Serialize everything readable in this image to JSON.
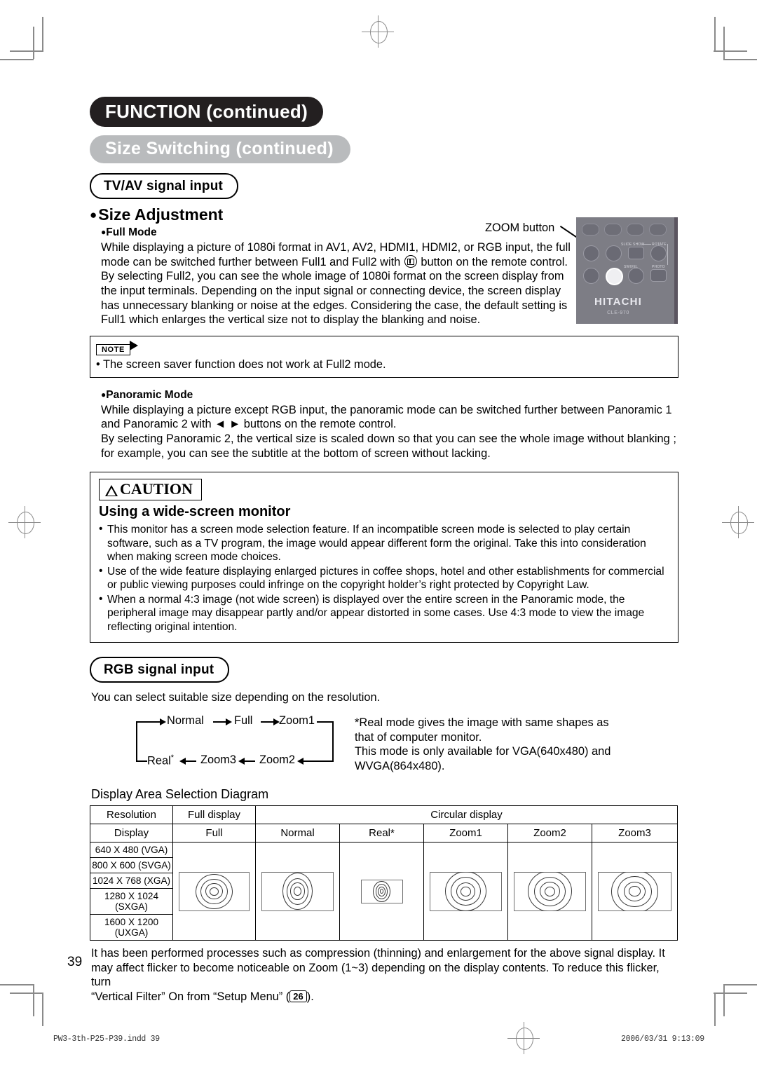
{
  "header": {
    "section_title": "FUNCTION (continued)",
    "subsection_title": "Size Switching (continued)",
    "signal_pill": "TV/AV signal input"
  },
  "size_adjustment": {
    "heading": "Size Adjustment",
    "full_mode": {
      "heading": "Full Mode",
      "lines": [
        "While displaying a picture of 1080i format in AV1, AV2, HDMI1, HDMI2, or RGB input, the full",
        "mode can be switched further between Full1 and Full2 with ",
        " button on the remote control.",
        "By selecting Full2, you can see the whole image of 1080i format on the screen display from",
        "the input terminals.  Depending on the input signal or connecting device, the screen display",
        "has unnecessary blanking or noise at the edges.  Considering the case, the default setting is",
        "Full1 which enlarges the vertical size not to display the blanking and noise."
      ]
    },
    "note": {
      "label": "NOTE",
      "text": "• The screen saver function does not work at Full2 mode."
    },
    "panoramic_mode": {
      "heading": "Panoramic Mode",
      "lines": [
        "While displaying a picture except RGB input, the panoramic mode can be switched further between Panoramic 1",
        "and Panoramic 2 with ◄ ► buttons on the remote control.",
        "By selecting Panoramic 2, the vertical size is scaled down so that you can see the whole image without blanking ;",
        "for example, you can see the subtitle at the bottom of screen without lacking."
      ]
    }
  },
  "remote": {
    "callout": "ZOOM button",
    "brand": "HITACHI",
    "model": "CLE-970",
    "labels": {
      "slide_show": "SLIDE SHOW",
      "rotate": "ROTATE",
      "swivel": "SWIVEL",
      "photo": "PHOTO"
    }
  },
  "caution": {
    "title": "CAUTION",
    "subtitle": "Using a wide-screen monitor",
    "bullets": [
      "This monitor has a screen mode selection feature. If an incompatible screen mode is selected to play certain software, such as a TV program, the image would appear different form the original. Take this into consideration when making screen mode choices.",
      "Use of the wide feature displaying enlarged pictures in coffee shops, hotel and other establishments for commercial or public viewing purposes could infringe on the copyright holder’s right protected by Copyright Law.",
      "When a normal 4:3 image (not wide screen) is displayed over the entire screen in the Panoramic mode, the peripheral image may disappear partly and/or appear distorted in some cases. Use 4:3 mode to view the image reflecting original intention."
    ]
  },
  "rgb": {
    "pill": "RGB signal input",
    "intro": "You can select suitable size depending on the resolution.",
    "flow_top": [
      "Normal",
      "Full",
      "Zoom1"
    ],
    "flow_bottom": [
      "Real",
      "Zoom3",
      "Zoom2"
    ],
    "flow_real_star": "*",
    "note_lines": [
      "*Real mode gives the image with same shapes as",
      " that of computer monitor.",
      "This mode is only available for VGA(640x480) and",
      "WVGA(864x480)."
    ]
  },
  "table": {
    "title": "Display Area Selection Diagram",
    "header_row1": [
      "Resolution",
      "Full display",
      "Circular display"
    ],
    "header_row2": [
      "Display",
      "Full",
      "Normal",
      "Real*",
      "Zoom1",
      "Zoom2",
      "Zoom3"
    ],
    "resolutions": [
      "640 X 480 (VGA)",
      "800 X 600 (SVGA)",
      "1024 X 768 (XGA)",
      "1280 X 1024 (SXGA)",
      "1600 X 1200 (UXGA)"
    ]
  },
  "footer_body": {
    "lines": [
      "It has been performed processes such as compression (thinning) and enlargement for the above signal display. It",
      "may affect flicker to become noticeable on Zoom (1~3) depending on the display contents. To reduce this flicker, turn",
      "“Vertical Filter” On from “Setup Menu” (",
      ")."
    ],
    "page_ref": "26",
    "page_number": "39"
  },
  "print_footer": {
    "left": "PW3-3th-P25-P39.indd   39",
    "right": "2006/03/31   9:13:09"
  }
}
